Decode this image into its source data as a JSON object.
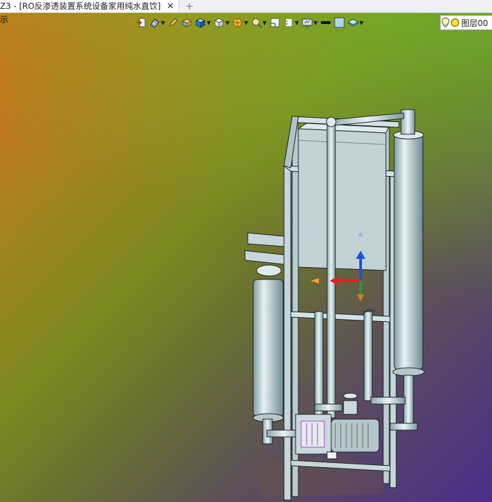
{
  "tab": {
    "title": "Z3 - [RO反渗透装置系统设备家用纯水直饮]",
    "close_glyph": "✕",
    "new_tab_glyph": "+"
  },
  "viewport": {
    "corner_text": "示",
    "background_colors": [
      "#d86a18",
      "#7e8a20",
      "#4a2e8c",
      "#6ebe28"
    ]
  },
  "toolbar": {
    "buttons": [
      {
        "name": "exit-icon"
      },
      {
        "name": "render-mode-icon",
        "dropdown": true
      },
      {
        "name": "pen-icon"
      },
      {
        "name": "shaded-box-icon"
      },
      {
        "name": "blue-cube-icon",
        "dropdown": true
      },
      {
        "name": "white-cube-view-icon",
        "dropdown": true
      },
      {
        "name": "section-view-icon",
        "dropdown": true
      },
      {
        "name": "zoom-fit-icon",
        "dropdown": true
      },
      {
        "name": "grid-icon"
      },
      {
        "name": "ruler-icon",
        "dropdown": true
      },
      {
        "name": "display-settings-icon",
        "dropdown": true
      },
      {
        "name": "line-weight-icon"
      },
      {
        "name": "color-swatch-icon"
      },
      {
        "name": "layer-stack-icon",
        "dropdown": true
      }
    ],
    "layer": {
      "bulb_icon": "light-bulb-icon",
      "color_icon": "yellow-circle-icon",
      "label": "图层00"
    }
  },
  "colors": {
    "model_fill": "#c8d8dc",
    "model_stroke": "#1a2226",
    "triad_x": "#e02020",
    "triad_y": "#2050e0",
    "triad_z": "#20a020"
  }
}
